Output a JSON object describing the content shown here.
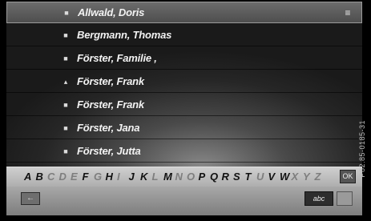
{
  "contacts": [
    {
      "name": "Allwald, Doris",
      "icon": "contact-card-icon",
      "selected": true
    },
    {
      "name": "Bergmann, Thomas",
      "icon": "contact-card-icon"
    },
    {
      "name": "Förster, Familie ,",
      "icon": "contact-card-icon"
    },
    {
      "name": "Förster, Frank",
      "icon": "contact-person-icon"
    },
    {
      "name": "Förster, Frank",
      "icon": "contact-card-icon"
    },
    {
      "name": "Förster, Jana",
      "icon": "contact-card-icon"
    },
    {
      "name": "Förster, Jutta",
      "icon": "contact-card-icon"
    }
  ],
  "keyboard": {
    "letters": [
      {
        "ch": "A",
        "enabled": true
      },
      {
        "ch": "B",
        "enabled": true
      },
      {
        "ch": "C",
        "enabled": false
      },
      {
        "ch": "D",
        "enabled": false
      },
      {
        "ch": "E",
        "enabled": false
      },
      {
        "ch": "F",
        "enabled": true
      },
      {
        "ch": "G",
        "enabled": false
      },
      {
        "ch": "H",
        "enabled": true
      },
      {
        "ch": "I",
        "enabled": false
      },
      {
        "ch": "J",
        "enabled": true
      },
      {
        "ch": "K",
        "enabled": true
      },
      {
        "ch": "L",
        "enabled": false
      },
      {
        "ch": "M",
        "enabled": true
      },
      {
        "ch": "N",
        "enabled": false
      },
      {
        "ch": "O",
        "enabled": false
      },
      {
        "ch": "P",
        "enabled": true
      },
      {
        "ch": "Q",
        "enabled": true
      },
      {
        "ch": "R",
        "enabled": true
      },
      {
        "ch": "S",
        "enabled": true
      },
      {
        "ch": "T",
        "enabled": true
      },
      {
        "ch": "U",
        "enabled": false
      },
      {
        "ch": "V",
        "enabled": true
      },
      {
        "ch": "W",
        "enabled": true
      },
      {
        "ch": "X",
        "enabled": false
      },
      {
        "ch": "Y",
        "enabled": false
      },
      {
        "ch": "Z",
        "enabled": false
      }
    ],
    "ok_label": "OK"
  },
  "bottom_bar": {
    "back_icon": "back-arrow-icon",
    "mode_label": "abc"
  },
  "watermark": "P82.85-0185-31"
}
